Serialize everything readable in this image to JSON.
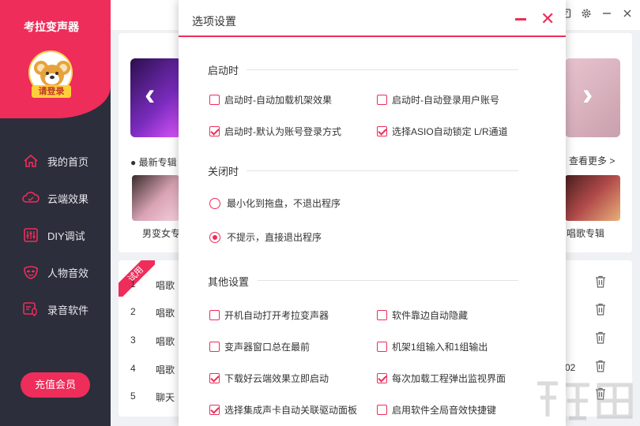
{
  "app": {
    "name": "考拉变声器",
    "login_label": "请登录",
    "vip_button": "充值会员"
  },
  "sidebar": {
    "items": [
      {
        "label": "我的首页",
        "icon": "home-icon"
      },
      {
        "label": "云端效果",
        "icon": "cloud-icon"
      },
      {
        "label": "DIY调试",
        "icon": "equalizer-icon"
      },
      {
        "label": "人物音效",
        "icon": "mask-icon"
      },
      {
        "label": "录音软件",
        "icon": "record-icon"
      }
    ]
  },
  "main": {
    "latest_label": "● 最新专辑",
    "see_more": "查看更多 >",
    "album_left_caption": "男变女专",
    "album_right_caption": "唱歌专辑",
    "trial_badge": "试用",
    "list_rows": [
      {
        "num": "1",
        "name": "唱歌"
      },
      {
        "num": "2",
        "name": "唱歌"
      },
      {
        "num": "3",
        "name": "唱歌"
      },
      {
        "num": "4",
        "name": "唱歌"
      },
      {
        "num": "5",
        "name": "聊天"
      }
    ],
    "side_number": "02"
  },
  "dialog": {
    "title": "选项设置",
    "sections": {
      "startup": {
        "title": "启动时",
        "options": [
          {
            "label": "启动时-自动加载机架效果",
            "checked": false
          },
          {
            "label": "启动时-自动登录用户账号",
            "checked": false
          },
          {
            "label": "启动时-默认为账号登录方式",
            "checked": true
          },
          {
            "label": "选择ASIO自动锁定 L/R通道",
            "checked": true
          }
        ]
      },
      "close": {
        "title": "关闭时",
        "options": [
          {
            "label": "最小化到拖盘，不退出程序",
            "selected": false
          },
          {
            "label": "不提示，直接退出程序",
            "selected": true
          }
        ]
      },
      "other": {
        "title": "其他设置",
        "options": [
          {
            "label": "开机自动打开考拉变声器",
            "checked": false
          },
          {
            "label": "软件靠边自动隐藏",
            "checked": false
          },
          {
            "label": "变声器窗口总在最前",
            "checked": false
          },
          {
            "label": "机架1组输入和1组输出",
            "checked": false
          },
          {
            "label": "下载好云端效果立即启动",
            "checked": true
          },
          {
            "label": "每次加载工程弹出监视界面",
            "checked": true
          },
          {
            "label": "选择集成声卡自动关联驱动面板",
            "checked": true
          },
          {
            "label": "启用软件全局音效快捷键",
            "checked": false
          }
        ]
      }
    }
  },
  "colors": {
    "accent": "#ee2d5a",
    "sidebar_bg": "#2c2e3b"
  }
}
